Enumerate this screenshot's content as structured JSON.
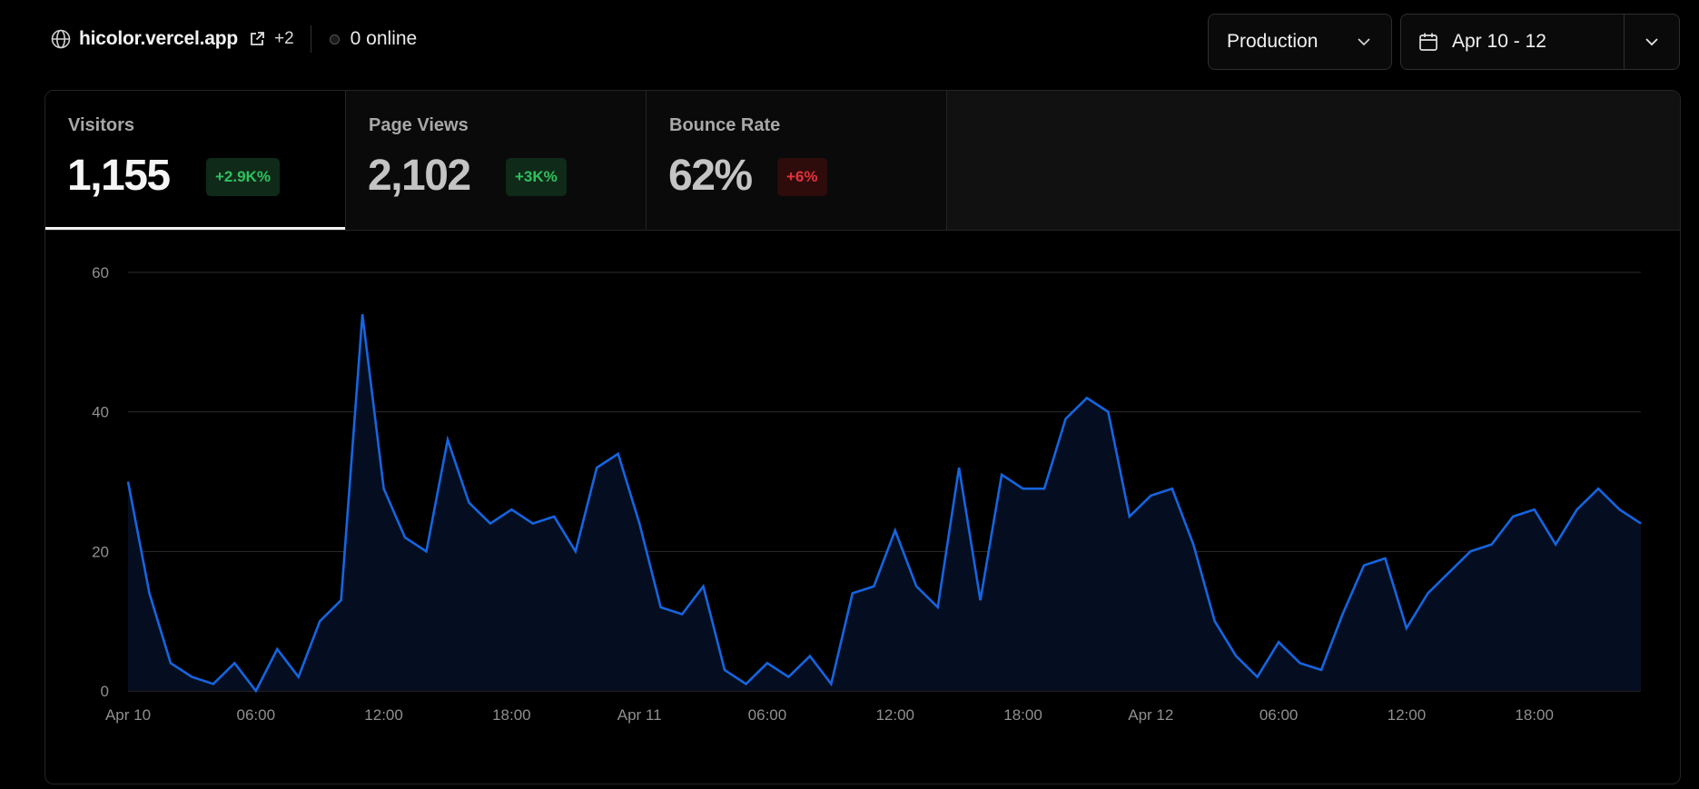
{
  "header": {
    "domain": "hicolor.vercel.app",
    "more_count": "+2",
    "online_status": "0 online",
    "icons": {
      "site": "globe-icon",
      "external": "external-link-icon",
      "online": "status-dot-icon"
    }
  },
  "controls": {
    "environment": "Production",
    "date_range": "Apr 10 - 12",
    "icons": {
      "environment": "chevron-down-icon",
      "date": "calendar-icon",
      "expand": "chevron-down-icon"
    }
  },
  "stats": [
    {
      "title": "Visitors",
      "value": "1,155",
      "change": "+2.9K%",
      "trend": "up",
      "active": true
    },
    {
      "title": "Page Views",
      "value": "2,102",
      "change": "+3K%",
      "trend": "up",
      "active": false
    },
    {
      "title": "Bounce Rate",
      "value": "62%",
      "change": "+6%",
      "trend": "down",
      "active": false
    }
  ],
  "colors": {
    "line": "#1565e0",
    "area": "#050e20",
    "grid": "#2b2b2b",
    "positive": "#2fc15f",
    "negative": "#e5313b"
  },
  "chart_data": {
    "type": "area",
    "series": [
      {
        "values": [
          30,
          14,
          4,
          2,
          1,
          4,
          0,
          6,
          2,
          10,
          13,
          54,
          29,
          22,
          20,
          36,
          27,
          24,
          26,
          24,
          25,
          20,
          32,
          34,
          24,
          12,
          11,
          15,
          3,
          1,
          4,
          2,
          5,
          1,
          14,
          15,
          23,
          15,
          12,
          32,
          13,
          31,
          29,
          29,
          39,
          42,
          40,
          25,
          28,
          29,
          21,
          10,
          5,
          2,
          7,
          4,
          3,
          11,
          18,
          19,
          9,
          14,
          17,
          20,
          21,
          25,
          26,
          21,
          26,
          29,
          26,
          24
        ]
      }
    ],
    "x_tick_labels": [
      "Apr 10",
      "06:00",
      "12:00",
      "18:00",
      "Apr 11",
      "06:00",
      "12:00",
      "18:00",
      "Apr 12",
      "06:00",
      "12:00",
      "18:00"
    ],
    "x_tick_hours": [
      0,
      6,
      12,
      18,
      24,
      30,
      36,
      42,
      48,
      54,
      60,
      66
    ],
    "x_range_hours": [
      0,
      71
    ],
    "y_ticks": [
      0,
      20,
      40,
      60
    ],
    "ylim": [
      0,
      60
    ],
    "grid": true,
    "legend": "none"
  }
}
